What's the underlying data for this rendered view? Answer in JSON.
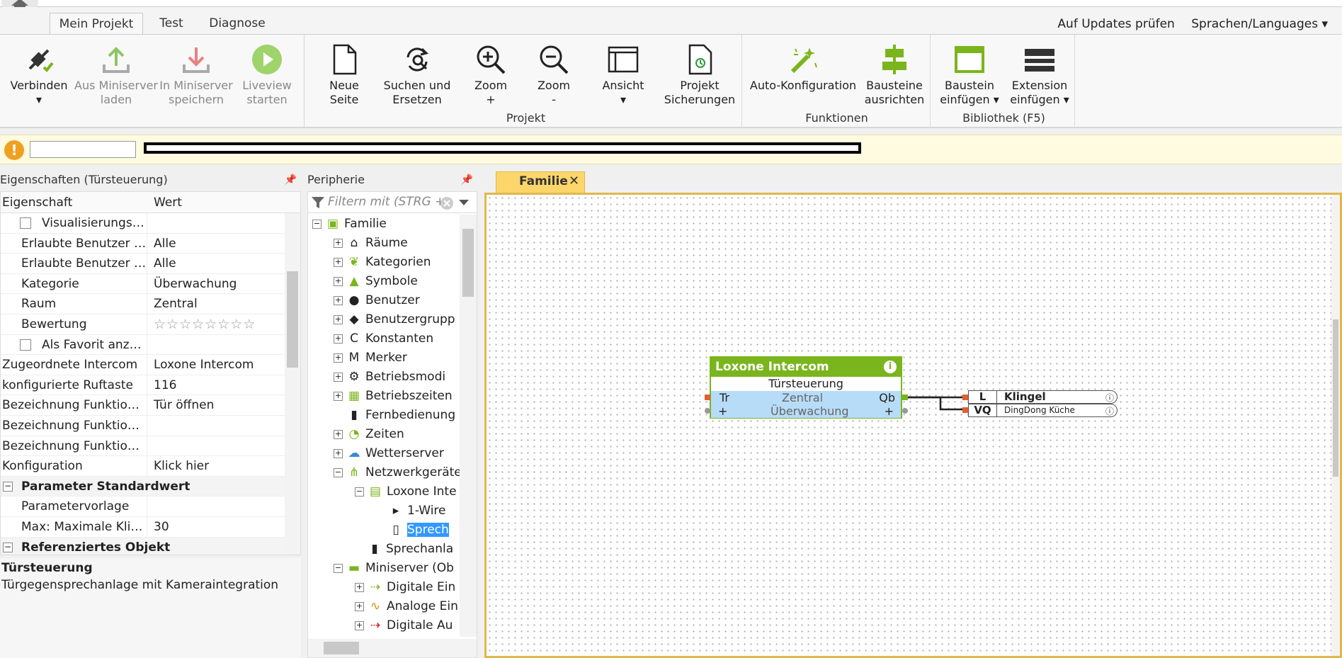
{
  "tabs": [
    "Mein Projekt",
    "Test",
    "Diagnose"
  ],
  "right_links": [
    "Auf Updates prüfen",
    "Sprachen/Languages ▾"
  ],
  "ribbon": {
    "group1": [
      {
        "label1": "Verbinden",
        "label2": "▾"
      },
      {
        "label1": "Aus Miniserver",
        "label2": "laden"
      },
      {
        "label1": "In Miniserver",
        "label2": "speichern"
      },
      {
        "label1": "Liveview",
        "label2": "starten"
      }
    ],
    "projekt": {
      "label": "Projekt",
      "buttons": [
        {
          "label1": "Neue",
          "label2": "Seite"
        },
        {
          "label1": "Suchen und",
          "label2": "Ersetzen"
        },
        {
          "label1": "Zoom",
          "label2": "+"
        },
        {
          "label1": "Zoom",
          "label2": "-"
        },
        {
          "label1": "Ansicht",
          "label2": "▾"
        },
        {
          "label1": "Projekt",
          "label2": "Sicherungen"
        }
      ]
    },
    "funktionen": {
      "label": "Funktionen",
      "buttons": [
        {
          "label1": "Auto-Konfiguration",
          "label2": ""
        },
        {
          "label1": "Bausteine",
          "label2": "ausrichten"
        }
      ]
    },
    "bibliothek": {
      "label": "Bibliothek (F5)",
      "buttons": [
        {
          "label1": "Baustein",
          "label2": "einfügen ▾"
        },
        {
          "label1": "Extension",
          "label2": "einfügen ▾"
        }
      ]
    }
  },
  "info_icon": "!",
  "properties": {
    "title": "Eigenschaften (Türsteuerung)",
    "col_name": "Eigenschaft",
    "col_value": "Wert",
    "rows": [
      {
        "name": "Visualisierungsk...",
        "value": ""
      },
      {
        "name": "Erlaubte Benutzer lo...",
        "value": "Alle"
      },
      {
        "name": "Erlaubte Benutzer In...",
        "value": "Alle"
      },
      {
        "name": "Kategorie",
        "value": "Überwachung"
      },
      {
        "name": "Raum",
        "value": "Zentral"
      },
      {
        "name": "Bewertung",
        "value": "☆☆☆☆☆☆☆☆"
      },
      {
        "name": "Als Favorit anzei...",
        "value": ""
      },
      {
        "name": "Zugeordnete Intercom",
        "value": "Loxone Intercom"
      },
      {
        "name": "konfigurierte Ruftaste",
        "value": "116"
      },
      {
        "name": "Bezeichnung Funktion ...",
        "value": "Tür öffnen"
      },
      {
        "name": "Bezeichnung Funktion ...",
        "value": ""
      },
      {
        "name": "Bezeichnung Funktion ...",
        "value": ""
      },
      {
        "name": "Konfiguration",
        "value": "Klick hier"
      },
      {
        "name": "Parameter Standardwert",
        "value": ""
      },
      {
        "name": "Parametervorlage",
        "value": ""
      },
      {
        "name": "Max: Maximale Klin...",
        "value": "30"
      },
      {
        "name": "Referenziertes Objekt",
        "value": ""
      }
    ],
    "desc_title": "Türsteuerung",
    "desc_text": "Türgegensprechanlage mit Kameraintegration"
  },
  "peripherie": {
    "title": "Peripherie",
    "filter_placeholder": "Filtern mit (STRG +",
    "tree": [
      {
        "label": "Familie",
        "icon": "▣"
      },
      {
        "label": "Räume",
        "icon": "⌂"
      },
      {
        "label": "Kategorien",
        "icon": "❦"
      },
      {
        "label": "Symbole",
        "icon": "▲"
      },
      {
        "label": "Benutzer",
        "icon": "●"
      },
      {
        "label": "Benutzergrupp",
        "icon": "◆"
      },
      {
        "label": "Konstanten",
        "icon": "C"
      },
      {
        "label": "Merker",
        "icon": "M"
      },
      {
        "label": "Betriebsmodi",
        "icon": "⚙"
      },
      {
        "label": "Betriebszeiten",
        "icon": "▦"
      },
      {
        "label": "Fernbedienung",
        "icon": "▮"
      },
      {
        "label": "Zeiten",
        "icon": "◔"
      },
      {
        "label": "Wetterserver",
        "icon": "☁"
      },
      {
        "label": "Netzwerkgeräte",
        "icon": "⋔"
      },
      {
        "label": "Loxone Inte",
        "icon": "▤"
      },
      {
        "label": "1-Wire",
        "icon": "▸"
      },
      {
        "label": "Sprech",
        "icon": "▯"
      },
      {
        "label": "Sprechanla",
        "icon": "▮"
      },
      {
        "label": "Miniserver (Ob",
        "icon": "▬"
      },
      {
        "label": "Digitale Ein",
        "icon": "⇢"
      },
      {
        "label": "Analoge Ein",
        "icon": "∿"
      },
      {
        "label": "Digitale Au",
        "icon": "⇢"
      }
    ]
  },
  "canvas": {
    "tab": "Familie",
    "close": "✕",
    "block": {
      "title": "Loxone Intercom",
      "subtitle": "Türsteuerung",
      "room": "Zentral",
      "category": "Überwachung",
      "input": "Tr",
      "output": "Qb",
      "plus": "+"
    },
    "outputs": [
      {
        "key": "L",
        "value": "Klingel"
      },
      {
        "key": "VQ",
        "value": "DingDong Küche"
      }
    ]
  }
}
